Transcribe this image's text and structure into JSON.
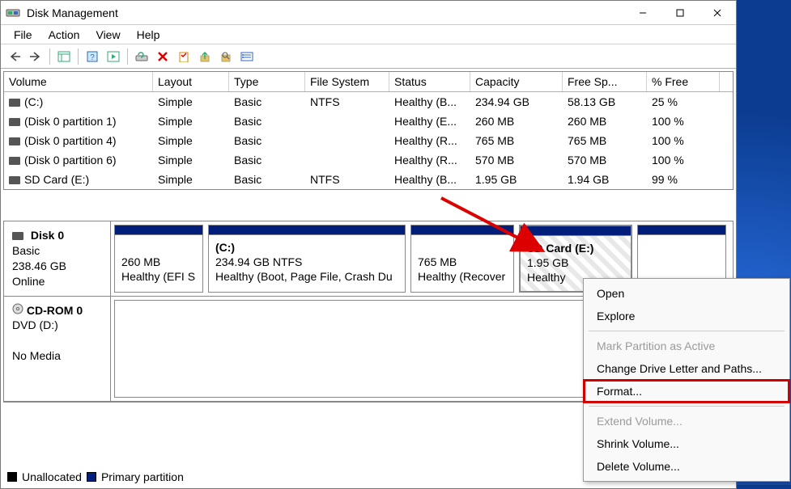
{
  "window": {
    "title": "Disk Management"
  },
  "menus": {
    "file": "File",
    "action": "Action",
    "view": "View",
    "help": "Help"
  },
  "table": {
    "headers": {
      "volume": "Volume",
      "layout": "Layout",
      "type": "Type",
      "fs": "File System",
      "status": "Status",
      "capacity": "Capacity",
      "free": "Free Sp...",
      "pct": "% Free"
    },
    "rows": [
      {
        "volume": "(C:)",
        "layout": "Simple",
        "type": "Basic",
        "fs": "NTFS",
        "status": "Healthy (B...",
        "capacity": "234.94 GB",
        "free": "58.13 GB",
        "pct": "25 %"
      },
      {
        "volume": "(Disk 0 partition 1)",
        "layout": "Simple",
        "type": "Basic",
        "fs": "",
        "status": "Healthy (E...",
        "capacity": "260 MB",
        "free": "260 MB",
        "pct": "100 %"
      },
      {
        "volume": "(Disk 0 partition 4)",
        "layout": "Simple",
        "type": "Basic",
        "fs": "",
        "status": "Healthy (R...",
        "capacity": "765 MB",
        "free": "765 MB",
        "pct": "100 %"
      },
      {
        "volume": "(Disk 0 partition 6)",
        "layout": "Simple",
        "type": "Basic",
        "fs": "",
        "status": "Healthy (R...",
        "capacity": "570 MB",
        "free": "570 MB",
        "pct": "100 %"
      },
      {
        "volume": "SD Card (E:)",
        "layout": "Simple",
        "type": "Basic",
        "fs": "NTFS",
        "status": "Healthy (B...",
        "capacity": "1.95 GB",
        "free": "1.94 GB",
        "pct": "99 %"
      }
    ]
  },
  "disk0": {
    "name": "Disk 0",
    "type": "Basic",
    "size": "238.46 GB",
    "state": "Online",
    "parts": {
      "p1": {
        "name": "",
        "size": "260 MB",
        "info": "Healthy (EFI S"
      },
      "p2": {
        "name": "(C:)",
        "size": "234.94 GB NTFS",
        "info": "Healthy (Boot, Page File, Crash Du"
      },
      "p3": {
        "name": "",
        "size": "765 MB",
        "info": "Healthy (Recover"
      },
      "p4": {
        "name": "SD Card  (E:)",
        "size": "1.95 GB",
        "info": "Healthy"
      }
    }
  },
  "cdrom": {
    "name": "CD-ROM 0",
    "type": "DVD (D:)",
    "state": "No Media"
  },
  "legend": {
    "unalloc": "Unallocated",
    "primary": "Primary partition"
  },
  "ctx": {
    "open": "Open",
    "explore": "Explore",
    "markactive": "Mark Partition as Active",
    "changeletter": "Change Drive Letter and Paths...",
    "format": "Format...",
    "extend": "Extend Volume...",
    "shrink": "Shrink Volume...",
    "delete": "Delete Volume..."
  }
}
